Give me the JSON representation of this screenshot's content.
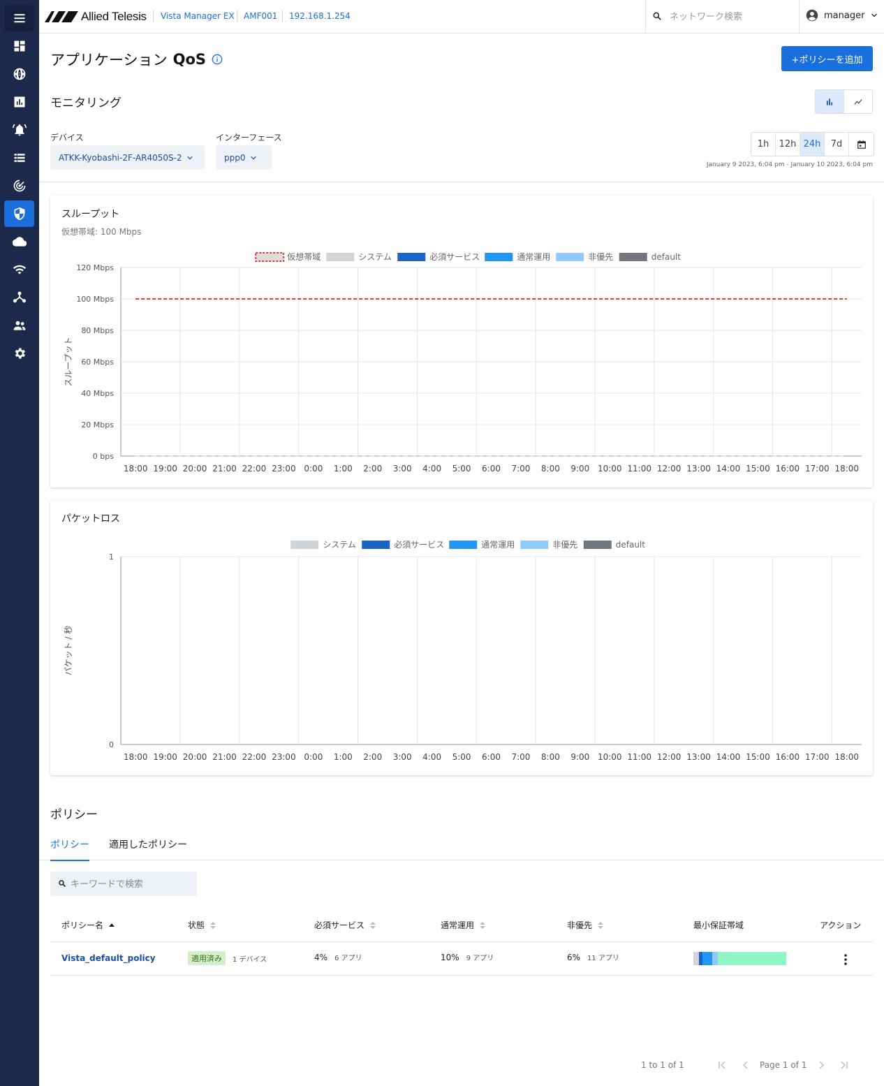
{
  "header": {
    "logo_text": "Allied Telesis",
    "breadcrumbs": [
      "Vista Manager EX",
      "AMF001",
      "192.168.1.254"
    ],
    "search_placeholder": "ネットワーク検索",
    "user": "manager"
  },
  "sidebar": {
    "items": [
      "menu",
      "dashboard",
      "globe",
      "chart",
      "alarm",
      "list",
      "radar",
      "shield",
      "cloud",
      "wifi",
      "topology",
      "users",
      "settings"
    ],
    "active": "shield"
  },
  "page": {
    "title_prefix": "アプリケーション",
    "title_bold": "QoS",
    "add_button": "+ポリシーを追加"
  },
  "monitoring": {
    "title": "モニタリング",
    "device_label": "デバイス",
    "device_value": "ATKK-Kyobashi-2F-AR4050S-2",
    "interface_label": "インターフェース",
    "interface_value": "ppp0",
    "ranges": [
      "1h",
      "12h",
      "24h",
      "7d"
    ],
    "selected_range": "24h",
    "date_range": "January 9 2023, 6:04 pm - January 10 2023, 6:04 pm"
  },
  "throughput": {
    "title": "スループット",
    "subtitle": "仮想帯域: 100 Mbps"
  },
  "packetloss": {
    "title": "パケットロス"
  },
  "chart_data": [
    {
      "type": "line",
      "title": "スループット",
      "ylabel": "スループット",
      "xlabel": "",
      "x": [
        "18:00",
        "19:00",
        "20:00",
        "21:00",
        "22:00",
        "23:00",
        "0:00",
        "1:00",
        "2:00",
        "3:00",
        "4:00",
        "5:00",
        "6:00",
        "7:00",
        "8:00",
        "9:00",
        "10:00",
        "11:00",
        "12:00",
        "13:00",
        "14:00",
        "15:00",
        "16:00",
        "17:00",
        "18:00"
      ],
      "yticks": [
        "0 bps",
        "20 Mbps",
        "40 Mbps",
        "60 Mbps",
        "80 Mbps",
        "100 Mbps",
        "120 Mbps"
      ],
      "ylim": [
        0,
        120
      ],
      "legend": [
        {
          "name": "仮想帯域",
          "color": "#e53935",
          "style": "dashed"
        },
        {
          "name": "システム",
          "color": "#cfd4db"
        },
        {
          "name": "必須サービス",
          "color": "#1c63c3"
        },
        {
          "name": "通常運用",
          "color": "#2196f3"
        },
        {
          "name": "非優先",
          "color": "#90caf9"
        },
        {
          "name": "default",
          "color": "#6f767e"
        }
      ],
      "series": [
        {
          "name": "仮想帯域",
          "values": [
            100,
            100,
            100,
            100,
            100,
            100,
            100,
            100,
            100,
            100,
            100,
            100,
            100,
            100,
            100,
            100,
            100,
            100,
            100,
            100,
            100,
            100,
            100,
            100,
            100
          ]
        },
        {
          "name": "システム",
          "values": [
            0,
            0,
            0,
            0,
            0,
            0,
            0,
            0,
            0,
            0,
            0,
            0,
            0,
            0,
            0,
            0,
            0,
            0,
            0,
            0,
            0,
            0,
            0,
            0,
            0
          ]
        }
      ],
      "legend_position": "top"
    },
    {
      "type": "line",
      "title": "パケットロス",
      "ylabel": "パケット / 秒",
      "xlabel": "",
      "x": [
        "18:00",
        "19:00",
        "20:00",
        "21:00",
        "22:00",
        "23:00",
        "0:00",
        "1:00",
        "2:00",
        "3:00",
        "4:00",
        "5:00",
        "6:00",
        "7:00",
        "8:00",
        "9:00",
        "10:00",
        "11:00",
        "12:00",
        "13:00",
        "14:00",
        "15:00",
        "16:00",
        "17:00",
        "18:00"
      ],
      "yticks": [
        "0",
        "1"
      ],
      "ylim": [
        0,
        1
      ],
      "legend": [
        {
          "name": "システム",
          "color": "#cfd4db"
        },
        {
          "name": "必須サービス",
          "color": "#1c63c3"
        },
        {
          "name": "通常運用",
          "color": "#2196f3"
        },
        {
          "name": "非優先",
          "color": "#90caf9"
        },
        {
          "name": "default",
          "color": "#6f767e"
        }
      ],
      "series": [],
      "legend_position": "top"
    }
  ],
  "policy": {
    "title": "ポリシー",
    "tabs": [
      "ポリシー",
      "適用したポリシー"
    ],
    "search_placeholder": "キーワードで検索",
    "columns": [
      "ポリシー名",
      "状態",
      "必須サービス",
      "通常運用",
      "非優先",
      "最小保証帯域",
      "アクション"
    ],
    "rows": [
      {
        "name": "Vista_default_policy",
        "status": "適用済み",
        "devices": "1 デバイス",
        "essential_pct": "4%",
        "essential_apps": "6 アプリ",
        "normal_pct": "10%",
        "normal_apps": "9 アプリ",
        "low_pct": "6%",
        "low_apps": "11 アプリ",
        "min_bandwidth": [
          {
            "fraction": 0.06,
            "color": "#cfd4db"
          },
          {
            "fraction": 0.04,
            "color": "#1c63c3"
          },
          {
            "fraction": 0.1,
            "color": "#2196f3"
          },
          {
            "fraction": 0.06,
            "color": "#90caf9"
          },
          {
            "fraction": 0.74,
            "color": "#8ff5c4"
          }
        ]
      }
    ],
    "pager_count": "1 to 1 of 1",
    "pager_page": "Page 1 of 1"
  }
}
